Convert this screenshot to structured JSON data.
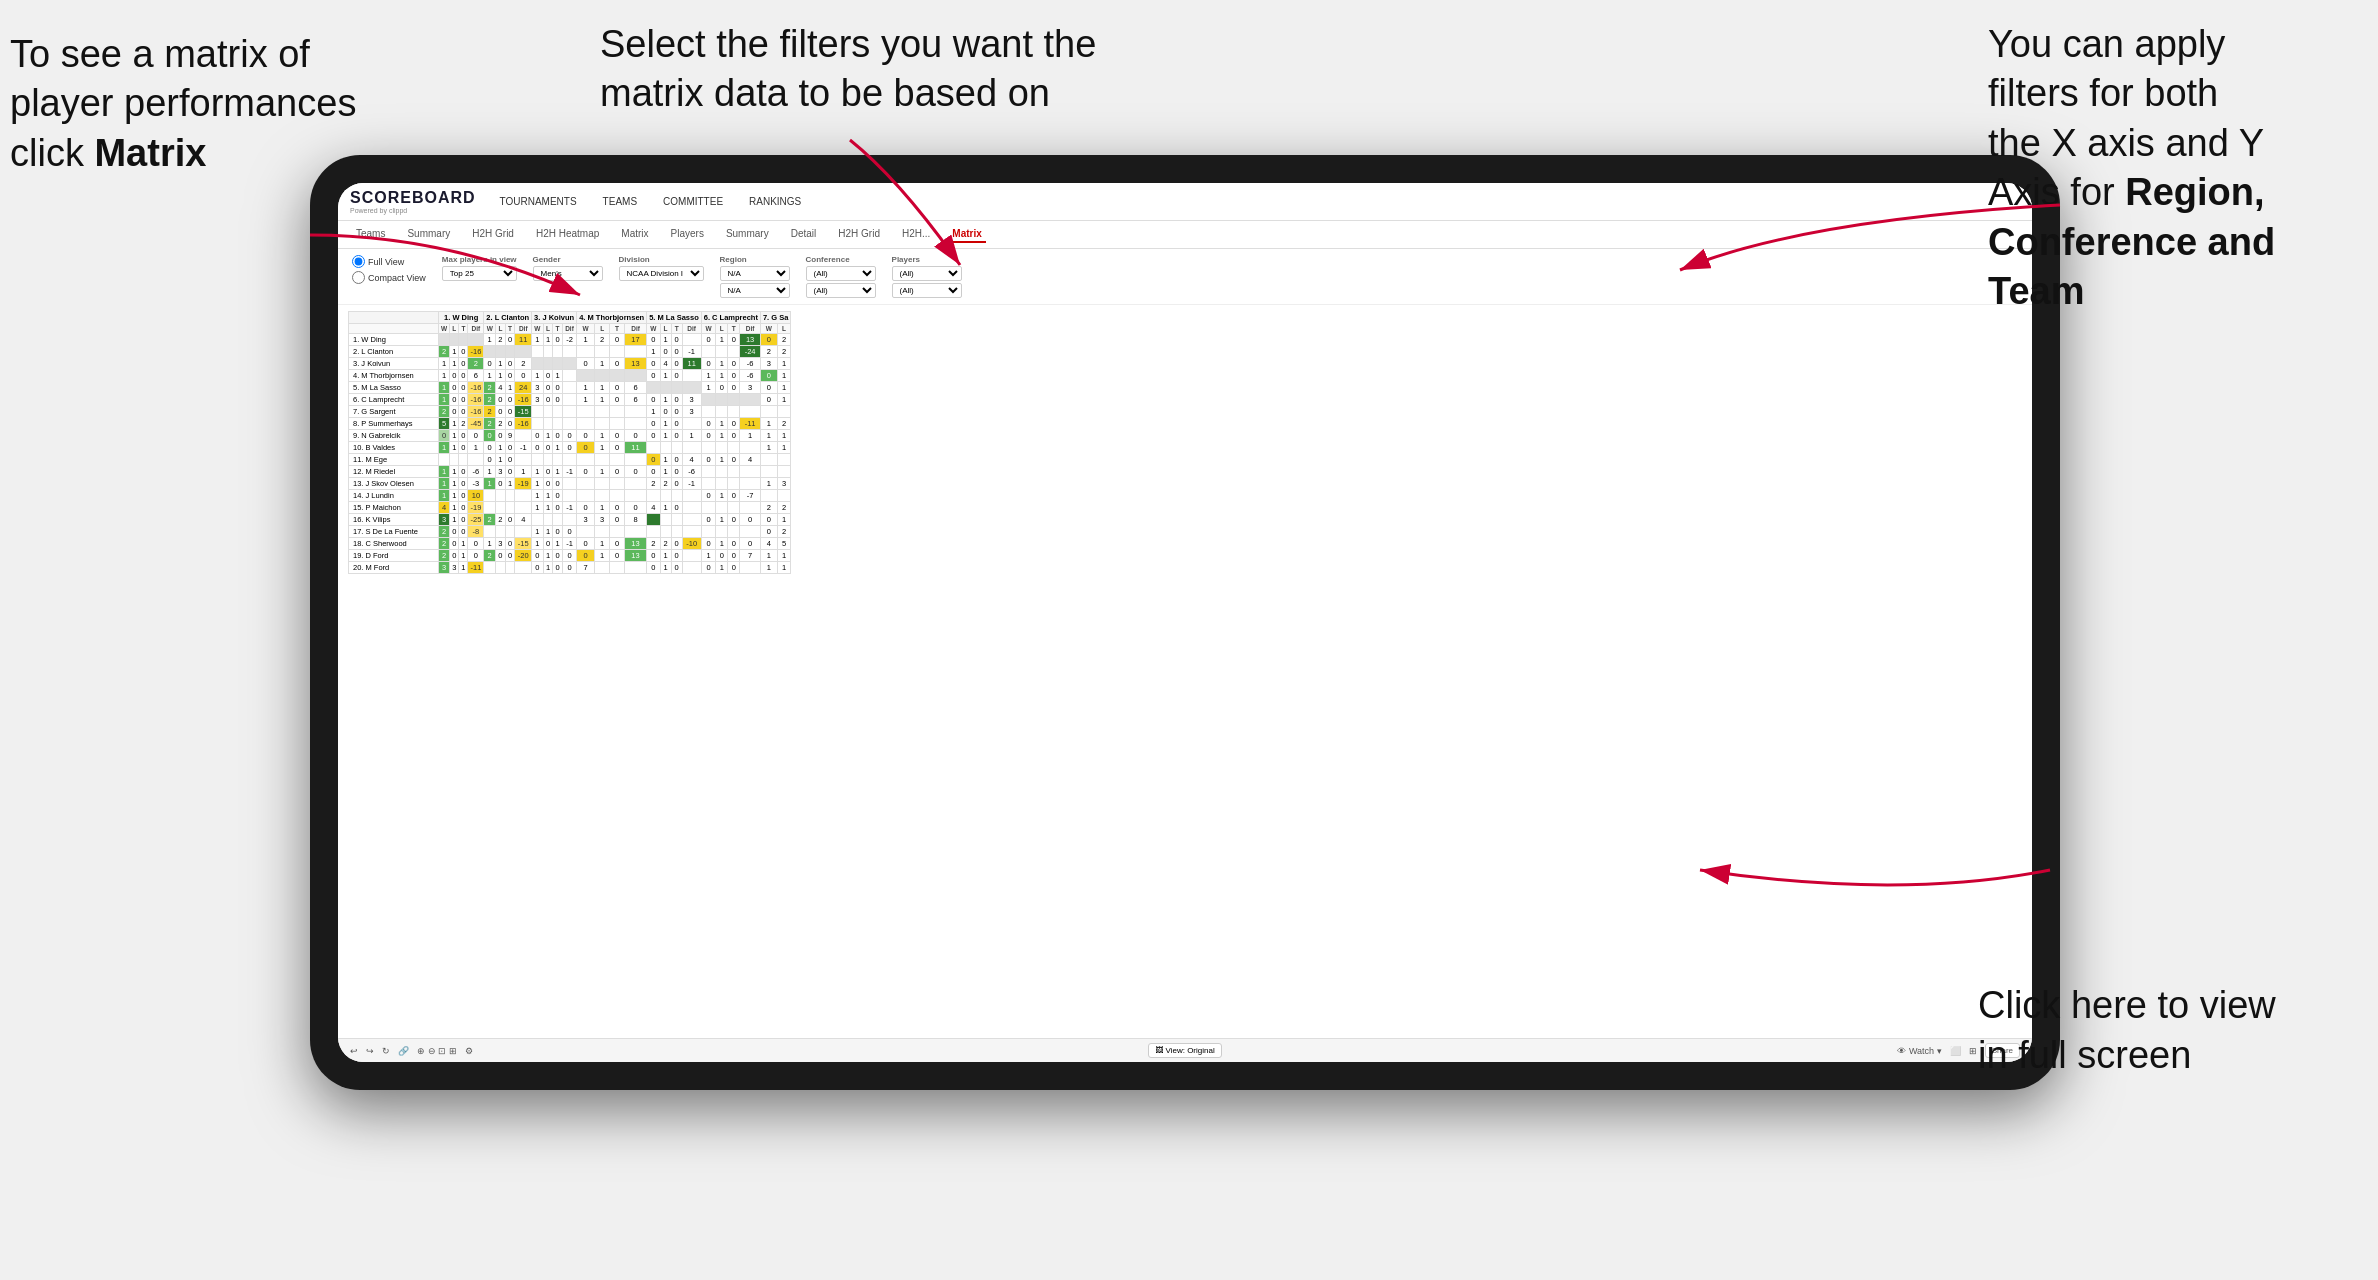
{
  "annotations": {
    "top_left": {
      "line1": "To see a matrix of",
      "line2": "player performances",
      "line3_normal": "click ",
      "line3_bold": "Matrix"
    },
    "top_center": {
      "text": "Select the filters you want the matrix data to be based on"
    },
    "top_right": {
      "line1": "You  can apply",
      "line2": "filters for both",
      "line3": "the X axis and Y",
      "line4_normal": "Axis for ",
      "line4_bold": "Region,",
      "line5_bold": "Conference and",
      "line6_bold": "Team"
    },
    "bottom_right": {
      "line1": "Click here to view",
      "line2": "in full screen"
    }
  },
  "app": {
    "logo": "SCOREBOARD",
    "logo_sub": "Powered by clippd",
    "nav_links": [
      "TOURNAMENTS",
      "TEAMS",
      "COMMITTEE",
      "RANKINGS"
    ],
    "sub_tabs": [
      "Teams",
      "Summary",
      "H2H Grid",
      "H2H Heatmap",
      "Matrix",
      "Players",
      "Summary",
      "Detail",
      "H2H Grid",
      "H2H...",
      "Matrix"
    ],
    "active_tab": "Matrix",
    "filters": {
      "view_options": [
        "Full View",
        "Compact View"
      ],
      "max_players_label": "Max players in view",
      "max_players_value": "Top 25",
      "gender_label": "Gender",
      "gender_value": "Men's",
      "division_label": "Division",
      "division_value": "NCAA Division I",
      "region_label": "Region",
      "region_value1": "N/A",
      "region_value2": "N/A",
      "conference_label": "Conference",
      "conference_value1": "(All)",
      "conference_value2": "(All)",
      "players_label": "Players",
      "players_value1": "(All)",
      "players_value2": "(All)"
    },
    "matrix_col_headers": [
      "1. W Ding",
      "2. L Clanton",
      "3. J Koivun",
      "4. M Thorbjornsen",
      "5. M La Sasso",
      "6. C Lamprecht",
      "7. G Sa"
    ],
    "matrix_sub_headers": [
      "W",
      "L",
      "T",
      "Dif"
    ],
    "player_rows": [
      "1. W Ding",
      "2. L Clanton",
      "3. J Koivun",
      "4. M Thorbjornsen",
      "5. M La Sasso",
      "6. C Lamprecht",
      "7. G Sargent",
      "8. P Summerhays",
      "9. N Gabrelcik",
      "10. B Valdes",
      "11. M Ege",
      "12. M Riedel",
      "13. J Skov Olesen",
      "14. J Lundin",
      "15. P Maichon",
      "16. K Vilips",
      "17. S De La Fuente",
      "18. C Sherwood",
      "19. D Ford",
      "20. M Ford"
    ],
    "bottom_toolbar": {
      "view_label": "View: Original",
      "watch_label": "Watch",
      "share_label": "Share"
    }
  }
}
